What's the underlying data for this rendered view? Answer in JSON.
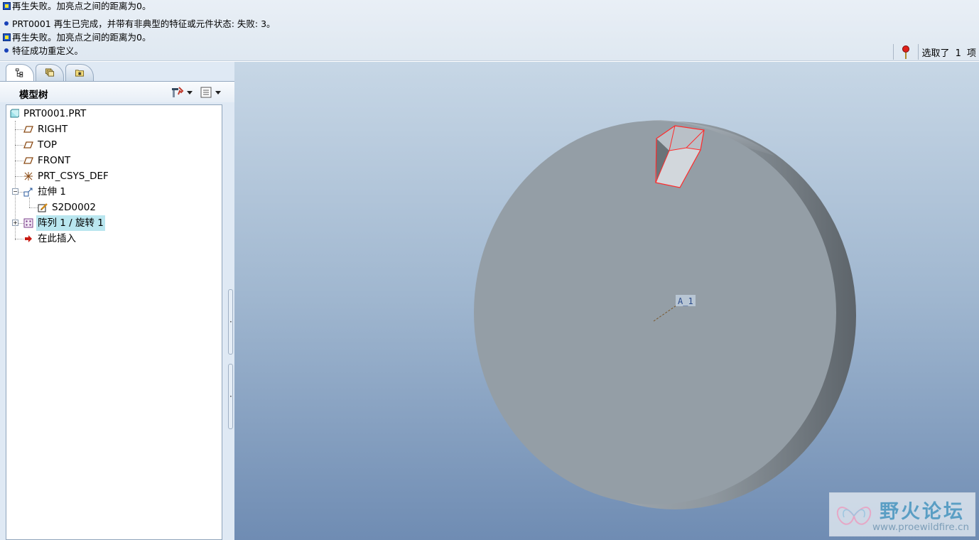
{
  "messages": [
    {
      "icon": "warning-icon",
      "text": "再生失败。加亮点之间的距离为0。"
    },
    {
      "icon": "info-dot-icon",
      "text": "PRT0001 再生已完成，并带有非典型的特征或元件状态: 失败: 3。"
    },
    {
      "icon": "warning-icon",
      "text": "再生失败。加亮点之间的距离为0。"
    },
    {
      "icon": "info-dot-icon",
      "text": "特征成功重定义。"
    }
  ],
  "status_bar": {
    "selection_text": "选取了 1 项",
    "light_icon": "regen-status-light-icon",
    "light_color": "#e0201a"
  },
  "left_panel": {
    "tabs": [
      {
        "name": "model-tree-tab",
        "icon": "tree-icon"
      },
      {
        "name": "layers-tab",
        "icon": "layers-icon"
      },
      {
        "name": "favorites-tab",
        "icon": "folder-star-icon"
      }
    ],
    "title": "模型树",
    "settings_icon": "tree-settings-icon",
    "show_icon": "tree-show-icon"
  },
  "tree": {
    "root": "PRT0001.PRT",
    "items": [
      {
        "label": "RIGHT",
        "icon": "datum-plane-icon"
      },
      {
        "label": "TOP",
        "icon": "datum-plane-icon"
      },
      {
        "label": "FRONT",
        "icon": "datum-plane-icon"
      },
      {
        "label": "PRT_CSYS_DEF",
        "icon": "csys-icon"
      },
      {
        "label": "拉伸 1",
        "icon": "extrude-icon",
        "expanded": true
      },
      {
        "label": "S2D0002",
        "icon": "sketch-icon"
      },
      {
        "label": "阵列 1 / 旋转 1",
        "icon": "pattern-icon",
        "expanded": false,
        "selected": true
      },
      {
        "label": "在此插入",
        "icon": "insert-here-arrow-icon"
      }
    ]
  },
  "viewport": {
    "axis_label": "A_1",
    "background_top": "#c7d7e6",
    "background_bottom": "#6f8cb3",
    "highlight_color": "#ff2a2a"
  },
  "watermark": {
    "title": "野火论坛",
    "url": "www.proewildfire.cn"
  }
}
